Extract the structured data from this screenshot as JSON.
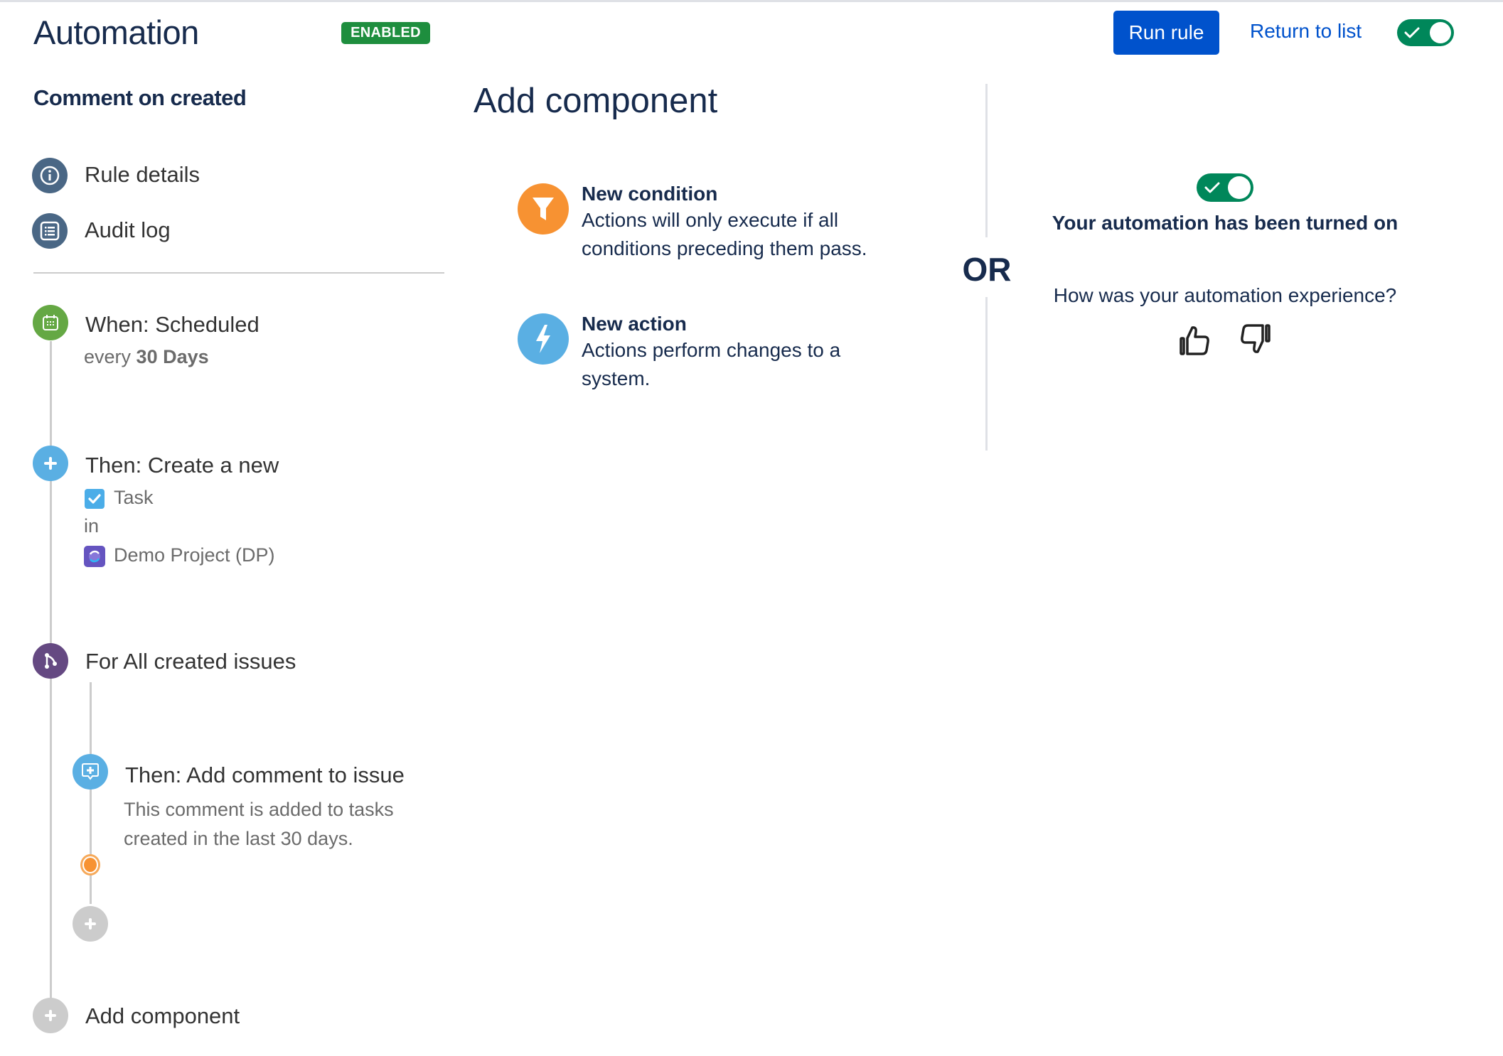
{
  "header": {
    "title": "Automation",
    "status_badge": "ENABLED",
    "run_rule_label": "Run rule",
    "return_link_label": "Return to list",
    "rule_toggle_on": true
  },
  "sidebar": {
    "rule_name": "Comment on created",
    "nav": [
      {
        "label": "Rule details",
        "icon": "info-icon"
      },
      {
        "label": "Audit log",
        "icon": "list-icon"
      }
    ]
  },
  "rule_flow": {
    "trigger": {
      "title": "When: Scheduled",
      "sub_prefix": "every",
      "sub_value": "30 Days",
      "icon": "calendar-icon",
      "color": "#65A844"
    },
    "create_action": {
      "title": "Then: Create a new",
      "issue_type": "Task",
      "connector": "in",
      "project": "Demo Project (DP)",
      "icon": "plus-icon",
      "color": "#5AAFE3"
    },
    "branch": {
      "title": "For All created issues",
      "icon": "branch-icon",
      "color": "#654982"
    },
    "branch_action": {
      "title": "Then: Add comment to issue",
      "desc_line1": "This comment is added to tasks",
      "desc_line2": "created in the last 30 days.",
      "icon": "comment-add-icon",
      "color": "#5AAFE3"
    },
    "add_component_label": "Add component"
  },
  "add_component_panel": {
    "title": "Add component",
    "options": [
      {
        "title": "New condition",
        "desc": "Actions will only execute if all conditions preceding them pass.",
        "icon": "filter-icon",
        "color": "#F79232"
      },
      {
        "title": "New action",
        "desc": "Actions perform changes to a system.",
        "icon": "lightning-icon",
        "color": "#5AAFE3"
      }
    ],
    "or_label": "OR"
  },
  "notification": {
    "toggle_on": true,
    "title": "Your automation has been turned on",
    "question": "How was your automation experience?",
    "feedback": [
      {
        "icon": "thumbs-up-icon"
      },
      {
        "icon": "thumbs-down-icon"
      }
    ]
  },
  "colors": {
    "primary": "#0052CC",
    "success": "#1E8E3E",
    "toggle_on": "#00875A",
    "text_dark": "#172B4D"
  }
}
